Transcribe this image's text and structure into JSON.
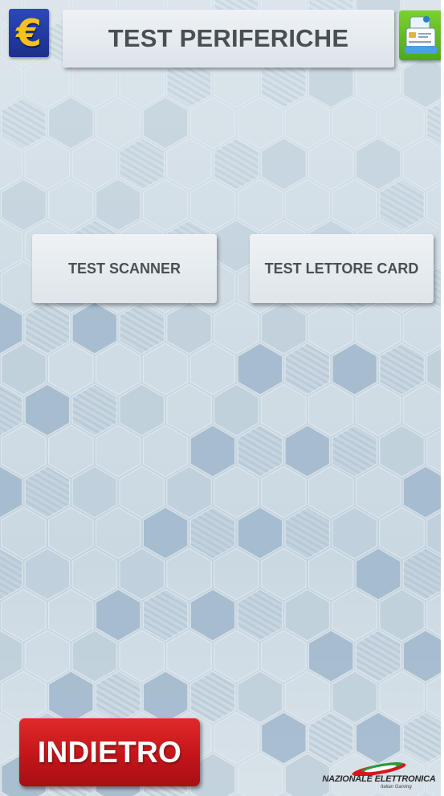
{
  "header": {
    "title": "TEST PERIFERICHE",
    "euro_icon_glyph": "€",
    "euro_icon": "euro-icon",
    "card_icon": "card-reader-icon"
  },
  "actions": {
    "scanner_label": "TEST SCANNER",
    "card_reader_label": "TEST LETTORE CARD"
  },
  "footer": {
    "back_label": "INDIETRO",
    "brand_name": "NAZIONALE ELETTRONICA",
    "brand_tagline": "Italian Gaming"
  },
  "colors": {
    "euro_bg": "#1c2f8a",
    "euro_glyph": "#f4c21b",
    "card_icon_bg": "#5cb51f",
    "back_button_bg": "#c3151a",
    "title_text": "#4a4f56"
  }
}
